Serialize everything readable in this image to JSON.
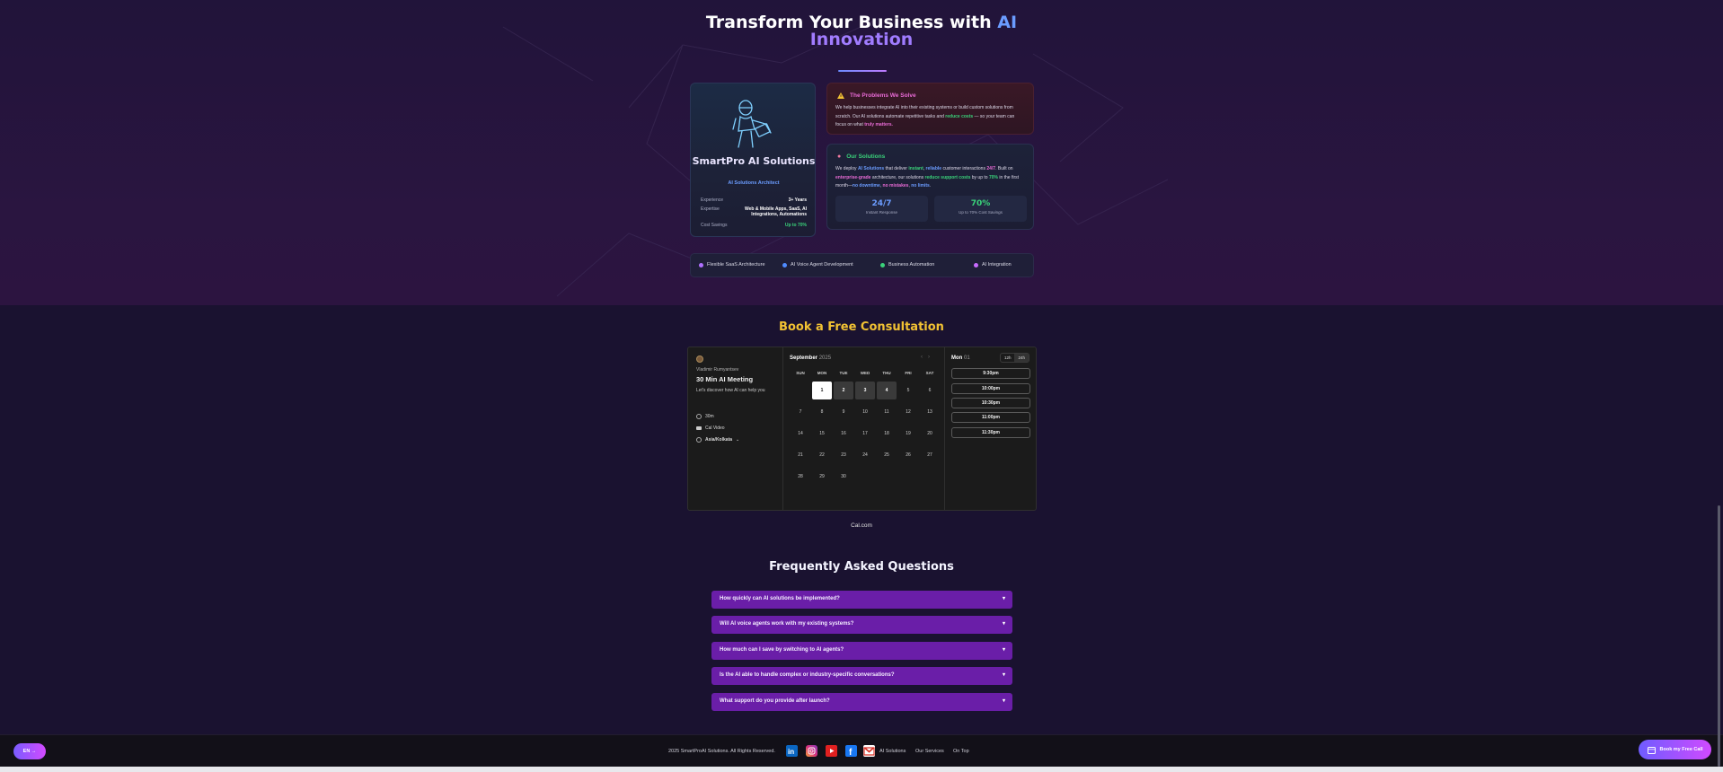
{
  "hero": {
    "title_part1": "Transform Your Business with",
    "title_ai": "AI",
    "title_part2": "Innovation"
  },
  "profile": {
    "name": "SmartPro AI Solutions",
    "role": "AI Solutions Architect",
    "rows": [
      {
        "label": "Experience",
        "value": "3+ Years"
      },
      {
        "label": "Expertise",
        "value": "Web & Mobile Apps, SaaS, AI Integrations, Automations"
      },
      {
        "label": "Cost Savings",
        "value": "Up to 70%"
      }
    ]
  },
  "problems": {
    "title": "The Problems We Solve",
    "text_a": "We help businesses integrate AI into their existing systems or build custom solutions from scratch. Our AI solutions automate repetitive tasks and",
    "hl_reduce": "reduce costs",
    "text_b": "— so your team can focus on what",
    "hl_matters": "truly matters."
  },
  "solutions": {
    "title": "Our Solutions",
    "t1": "We deploy",
    "h1": "AI Solutions",
    "t2": "that deliver",
    "h2": "instant",
    "t3": ",",
    "h3": "reliable",
    "t4": "customer interactions",
    "h4": "24/7",
    "t5": ". Built on",
    "h5": "enterprise-grade",
    "t6": "architecture, our solutions",
    "h6": "reduce support costs",
    "t7": "by up to",
    "h7": "70%",
    "t8": "in the first month—",
    "h8": "no downtime",
    "t9": ",",
    "h9": "no mistakes",
    "t10": ",",
    "h10": "no limits",
    "t11": ".",
    "stats": [
      {
        "num": "24/7",
        "label": "Instant Response"
      },
      {
        "num": "70%",
        "label": "Up to 70% Cost Savings"
      }
    ]
  },
  "tags": [
    {
      "label": "Flexible SaaS Architecture",
      "color": "#b070ff"
    },
    {
      "label": "AI Voice Agent Development",
      "color": "#4f8cff"
    },
    {
      "label": "Business Automation",
      "color": "#3ad27a"
    },
    {
      "label": "AI Integration",
      "color": "#c86bff"
    }
  ],
  "consult": {
    "title": "Book a Free Consultation",
    "host": "Vladimir Rumyantsev",
    "meeting": "30 Min AI Meeting",
    "desc": "Let's discover how AI can help you",
    "duration": "30m",
    "video": "Cal Video",
    "timezone": "Asia/Kolkata",
    "month": "September",
    "year": "2025",
    "dows": [
      "SUN",
      "MON",
      "TUE",
      "WED",
      "THU",
      "FRI",
      "SAT"
    ],
    "days": [
      "1",
      "2",
      "3",
      "4",
      "5",
      "6",
      "7",
      "8",
      "9",
      "10",
      "11",
      "12",
      "13",
      "14",
      "15",
      "16",
      "17",
      "18",
      "19",
      "20",
      "21",
      "22",
      "23",
      "24",
      "25",
      "26",
      "27",
      "28",
      "29",
      "30"
    ],
    "selected_day": "Mon",
    "selected_num": "01",
    "fmt12": "12h",
    "fmt24": "24h",
    "slots": [
      "9:30pm",
      "10:00pm",
      "10:30pm",
      "11:00pm",
      "11:30pm"
    ],
    "brand": "Cal.com"
  },
  "faq": {
    "title": "Frequently Asked Questions",
    "items": [
      "How quickly can AI solutions be implemented?",
      "Will AI voice agents work with my existing systems?",
      "How much can I save by switching to AI agents?",
      "Is the AI able to handle complex or industry-specific conversations?",
      "What support do you provide after launch?"
    ]
  },
  "footer": {
    "lang": "EN →",
    "copyright": "2025 SmartProAI Solutions. All Rights Reserved.",
    "links": [
      "AI Solutions",
      "Our Services",
      "On Top"
    ],
    "book": "Book my Free Call"
  },
  "colors": {
    "accent_blue": "#6b9cff",
    "accent_purple": "#b47cff",
    "gold": "#f2c233",
    "faq_purple": "#6a1ea8",
    "green": "#3ad27a"
  }
}
